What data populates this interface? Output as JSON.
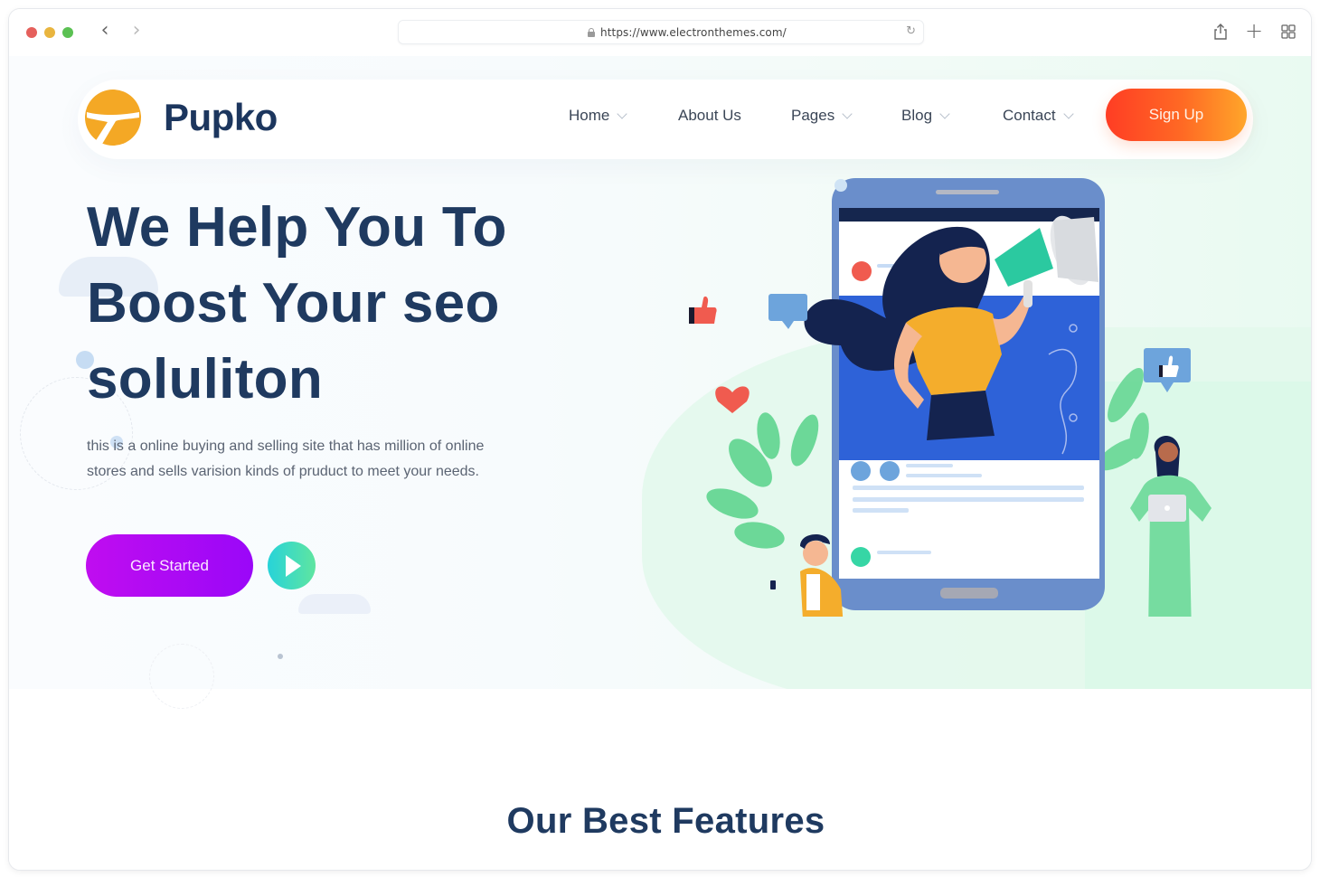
{
  "browser": {
    "url": "https://www.electronthemes.com/",
    "back_label": "‹",
    "forward_label": "›",
    "reload_label": "↻",
    "new_tab_label": "+"
  },
  "header": {
    "brand": "Pupko",
    "nav": [
      {
        "label": "Home",
        "has_dropdown": true
      },
      {
        "label": "About Us",
        "has_dropdown": false
      },
      {
        "label": "Pages",
        "has_dropdown": true
      },
      {
        "label": "Blog",
        "has_dropdown": true
      },
      {
        "label": "Contact",
        "has_dropdown": true
      }
    ],
    "signup_label": "Sign Up"
  },
  "hero": {
    "title_lines": [
      "We Help You To",
      "Boost Your seo",
      "soluliton"
    ],
    "description": "this is a online buying and selling site that has million of online stores and sells varision kinds of pruduct to meet your needs.",
    "cta_label": "Get Started",
    "play_icon": "play-icon"
  },
  "features": {
    "title": "Our Best Features"
  },
  "colors": {
    "brand_navy": "#1f3a60",
    "signup_gradient_start": "#ff3d24",
    "signup_gradient_end": "#ffa62a",
    "cta_purple": "#b00af3",
    "play_gradient_start": "#27d3d9",
    "play_gradient_end": "#5fe5a0",
    "logo_orange": "#f4a825"
  }
}
